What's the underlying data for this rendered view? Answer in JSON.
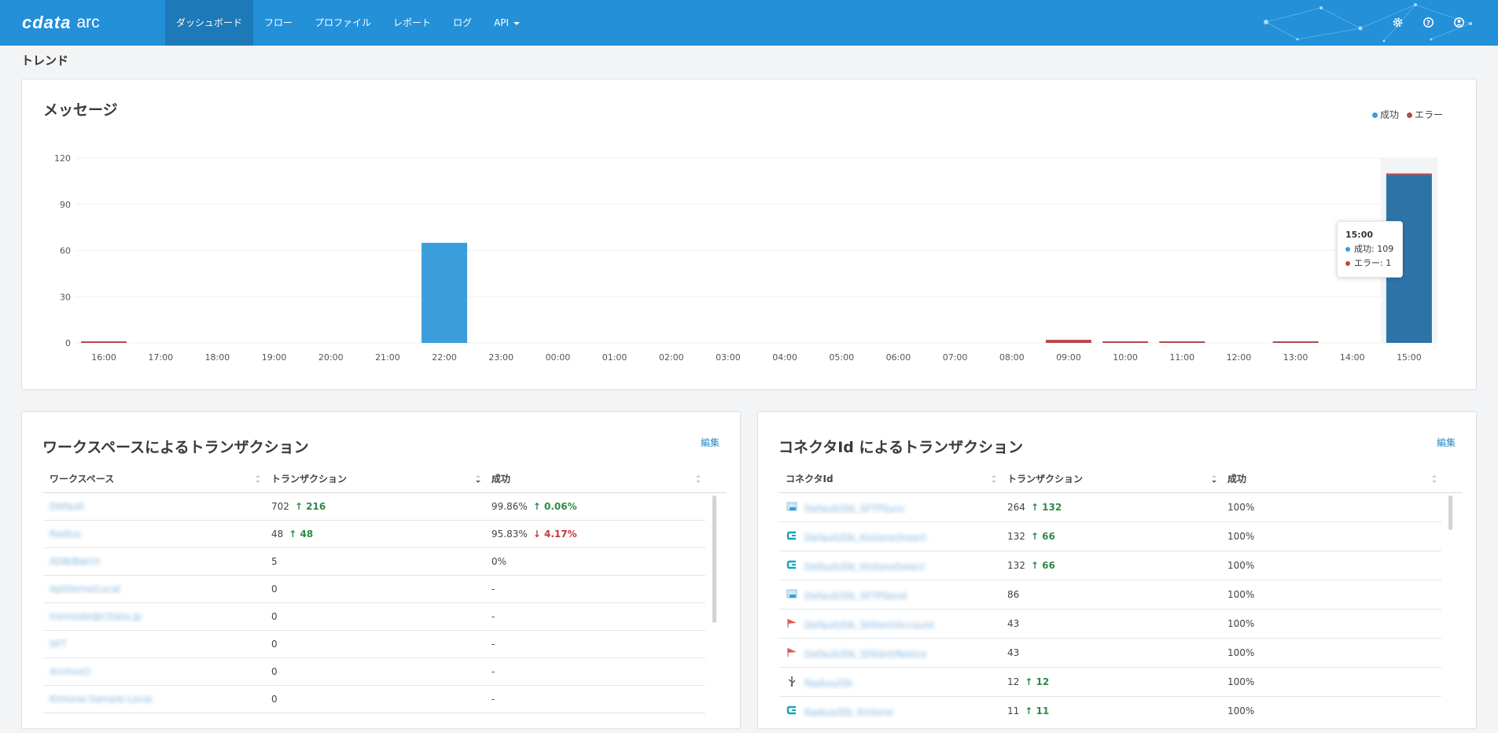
{
  "app": {
    "logo_mark": "cdata",
    "logo_sub": "arc"
  },
  "nav": {
    "items": [
      {
        "label": "ダッシュボード",
        "active": true
      },
      {
        "label": "フロー"
      },
      {
        "label": "プロファイル"
      },
      {
        "label": "レポート"
      },
      {
        "label": "ログ"
      },
      {
        "label": "API",
        "dropdown": true
      }
    ],
    "icons": [
      "gear-icon",
      "help-icon",
      "user-icon"
    ]
  },
  "section_title": "トレンド",
  "messages_panel": {
    "title": "メッセージ",
    "tooltip": {
      "time": "15:00",
      "success_label": "成功",
      "success_value": "109",
      "error_label": "エラー",
      "error_value": "1"
    }
  },
  "chart_data": {
    "type": "bar",
    "title": "メッセージ",
    "categories": [
      "16:00",
      "17:00",
      "18:00",
      "19:00",
      "20:00",
      "21:00",
      "22:00",
      "23:00",
      "00:00",
      "01:00",
      "02:00",
      "03:00",
      "04:00",
      "05:00",
      "06:00",
      "07:00",
      "08:00",
      "09:00",
      "10:00",
      "11:00",
      "12:00",
      "13:00",
      "14:00",
      "15:00"
    ],
    "series": [
      {
        "name": "成功",
        "color": "#3a9edb",
        "values": [
          0,
          0,
          0,
          0,
          0,
          0,
          65,
          0,
          0,
          0,
          0,
          0,
          0,
          0,
          0,
          0,
          0,
          0,
          0,
          0,
          0,
          0,
          0,
          109
        ]
      },
      {
        "name": "エラー",
        "color": "#b84a4a",
        "values": [
          1,
          0,
          0,
          0,
          0,
          0,
          0,
          0,
          0,
          0,
          0,
          0,
          0,
          0,
          0,
          0,
          0,
          2,
          1,
          1,
          0,
          1,
          0,
          1
        ]
      }
    ],
    "stacked": true,
    "ylim": [
      0,
      120
    ],
    "yticks": [
      0,
      30,
      60,
      90,
      120
    ],
    "legend_position": "top-right",
    "grid": true,
    "highlighted_category": "15:00",
    "highlight_color": "#2e73a8"
  },
  "workspace_panel": {
    "title": "ワークスペースによるトランザクション",
    "edit_label": "編集",
    "columns": [
      "ワークスペース",
      "トランザクション",
      "成功"
    ],
    "rows": [
      {
        "name": "Default",
        "count": "702",
        "delta": "216",
        "delta_dir": "up",
        "rate": "99.86%",
        "rate_delta": "0.06%",
        "rate_dir": "up"
      },
      {
        "name": "Radius",
        "count": "48",
        "delta": "48",
        "delta_dir": "up",
        "rate": "95.83%",
        "rate_delta": "4.17%",
        "rate_dir": "down"
      },
      {
        "name": "ADB/Batch",
        "count": "5",
        "delta": "",
        "delta_dir": "",
        "rate": "0%",
        "rate_delta": "",
        "rate_dir": ""
      },
      {
        "name": "ApiDemo/Local",
        "count": "0",
        "delta": "",
        "delta_dir": "",
        "rate": "-",
        "rate_delta": "",
        "rate_dir": ""
      },
      {
        "name": "Ironnode@CData.jp",
        "count": "0",
        "delta": "",
        "delta_dir": "",
        "rate": "-",
        "rate_delta": "",
        "rate_dir": ""
      },
      {
        "name": "SFT",
        "count": "0",
        "delta": "",
        "delta_dir": "",
        "rate": "-",
        "rate_delta": "",
        "rate_dir": ""
      },
      {
        "name": "Archive2",
        "count": "0",
        "delta": "",
        "delta_dir": "",
        "rate": "-",
        "rate_delta": "",
        "rate_dir": ""
      },
      {
        "name": "Kintone-Sample-Local",
        "count": "0",
        "delta": "",
        "delta_dir": "",
        "rate": "-",
        "rate_delta": "",
        "rate_dir": ""
      }
    ]
  },
  "connector_panel": {
    "title": "コネクタId によるトランザクション",
    "edit_label": "編集",
    "columns": [
      "コネクタId",
      "トランザクション",
      "成功"
    ],
    "rows": [
      {
        "icon": "file-icon",
        "name": "Default/Db_SFTPSync",
        "count": "264",
        "delta": "132",
        "delta_dir": "up",
        "rate": "100%"
      },
      {
        "icon": "cdata-connector-icon",
        "name": "Default/Db_Kintone/Insert",
        "count": "132",
        "delta": "66",
        "delta_dir": "up",
        "rate": "100%"
      },
      {
        "icon": "cdata-connector-icon",
        "name": "Default/Db_KintoneSelect",
        "count": "132",
        "delta": "66",
        "delta_dir": "up",
        "rate": "100%"
      },
      {
        "icon": "file-icon",
        "name": "Default/Db_SFTPSend",
        "count": "86",
        "delta": "",
        "delta_dir": "",
        "rate": "100%"
      },
      {
        "icon": "flag-icon",
        "name": "Default/Db_SFAlert/Account",
        "count": "43",
        "delta": "",
        "delta_dir": "",
        "rate": "100%"
      },
      {
        "icon": "flag-icon",
        "name": "Default/Db_SFAlert/Notice",
        "count": "43",
        "delta": "",
        "delta_dir": "",
        "rate": "100%"
      },
      {
        "icon": "usb-icon",
        "name": "Radius/Db",
        "count": "12",
        "delta": "12",
        "delta_dir": "up",
        "rate": "100%"
      },
      {
        "icon": "cdata-connector-icon",
        "name": "Radius/Db_Kintone",
        "count": "11",
        "delta": "11",
        "delta_dir": "up",
        "rate": "100%"
      }
    ]
  }
}
